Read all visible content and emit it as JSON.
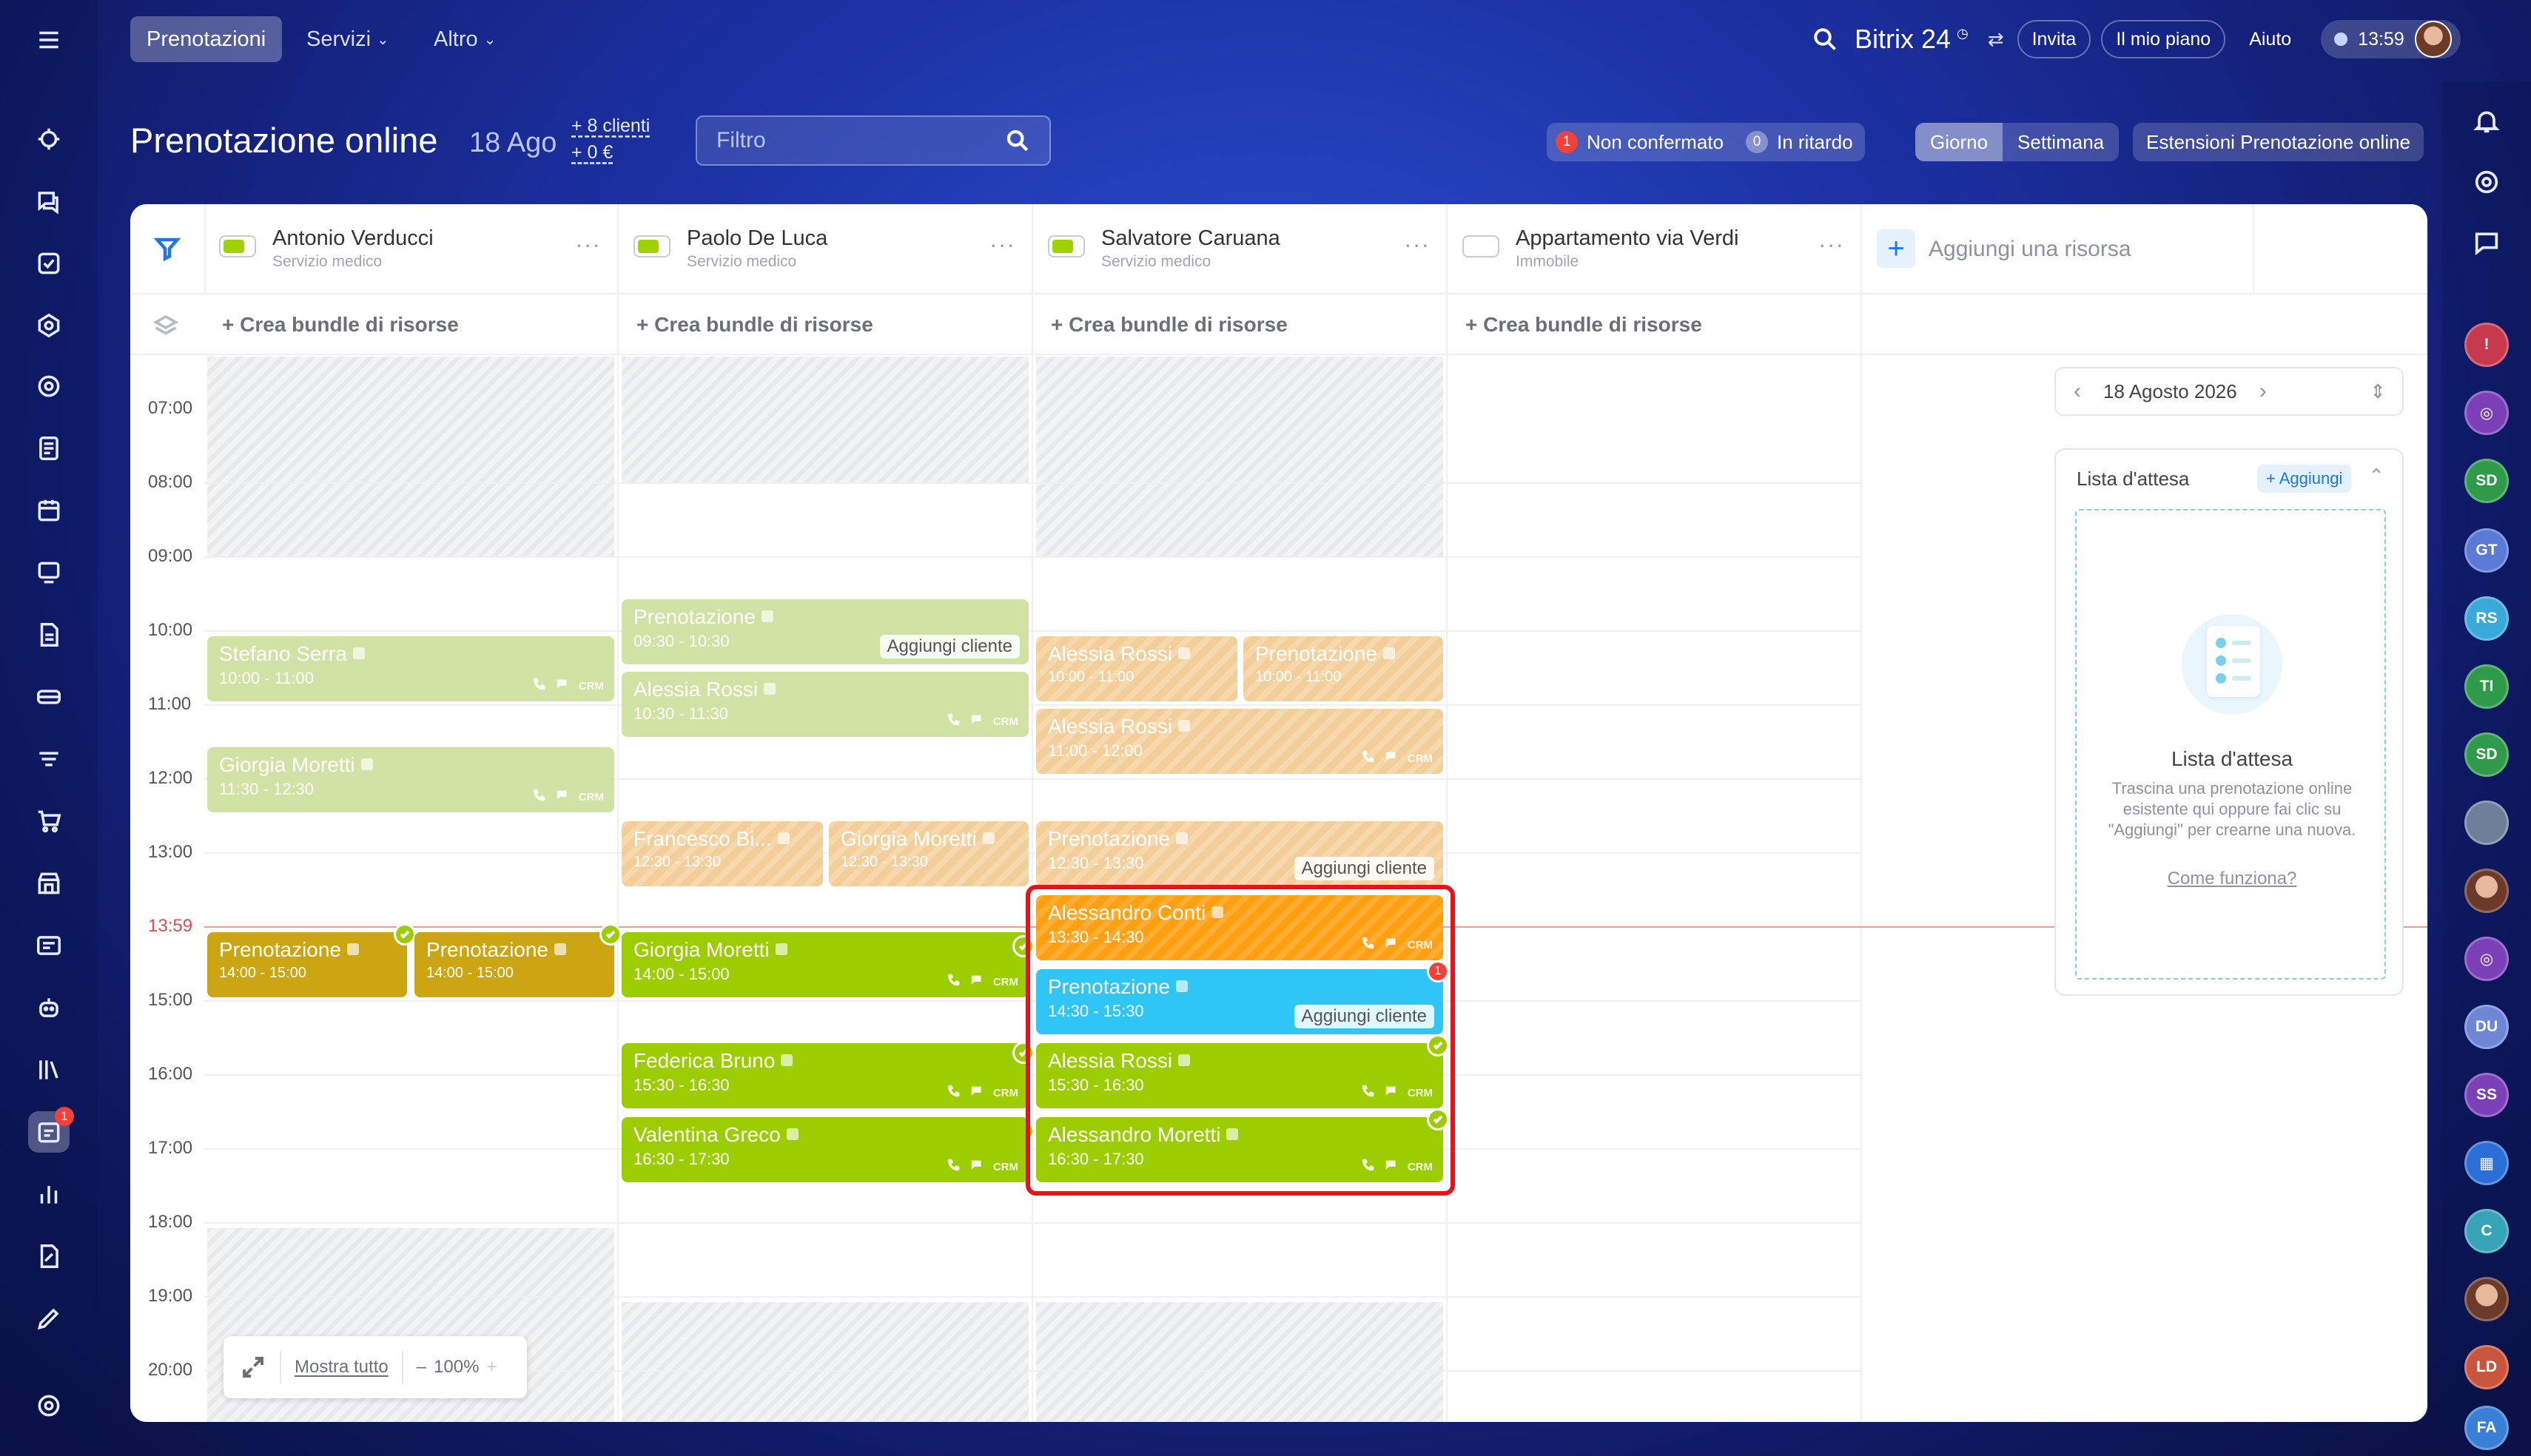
{
  "nav": {
    "tabs": [
      {
        "label": "Prenotazioni",
        "active": true
      },
      {
        "label": "Servizi",
        "active": false
      },
      {
        "label": "Altro",
        "active": false
      }
    ],
    "brand": "Bitrix 24",
    "invite": "Invita",
    "plan": "Il mio piano",
    "help": "Aiuto",
    "clock": "13:59"
  },
  "header": {
    "title": "Prenotazione online",
    "date": "18 Ago",
    "clients_stat": "+ 8 clienti",
    "revenue_stat": "+ 0 €",
    "filter_placeholder": "Filtro",
    "unconfirmed": {
      "count": "1",
      "label": "Non confermato"
    },
    "late": {
      "count": "0",
      "label": "In ritardo"
    },
    "view_day": "Giorno",
    "view_week": "Settimana",
    "extensions": "Estensioni Prenotazione online"
  },
  "resources": [
    {
      "name": "Antonio Verducci",
      "type": "Servizio medico",
      "enabled": true
    },
    {
      "name": "Paolo De Luca",
      "type": "Servizio medico",
      "enabled": true
    },
    {
      "name": "Salvatore Caruana",
      "type": "Servizio medico",
      "enabled": true
    },
    {
      "name": "Appartamento via Verdi",
      "type": "Immobile",
      "enabled": false
    }
  ],
  "add_resource": "Aggiungi una risorsa",
  "bundle_label": "+ Crea bundle di risorse",
  "times": [
    "07:00",
    "08:00",
    "09:00",
    "10:00",
    "11:00",
    "12:00",
    "13:00",
    "15:00",
    "16:00",
    "17:00",
    "18:00",
    "19:00",
    "20:00"
  ],
  "now_label": "13:59",
  "events": {
    "e1": {
      "title": "Stefano Serra",
      "time": "10:00 - 11:00",
      "crm": "CRM"
    },
    "e2": {
      "title": "Giorgia Moretti",
      "time": "11:30 - 12:30",
      "crm": "CRM"
    },
    "e3": {
      "title": "Prenotazione",
      "time": "14:00 - 15:00"
    },
    "e4": {
      "title": "Prenotazione",
      "time": "14:00 - 15:00"
    },
    "e5": {
      "title": "Prenotazione",
      "time": "09:30 - 10:30",
      "add": "Aggiungi cliente"
    },
    "e6": {
      "title": "Alessia Rossi",
      "time": "10:30 - 11:30",
      "crm": "CRM"
    },
    "e7": {
      "title": "Francesco Bi...",
      "time": "12:30 - 13:30"
    },
    "e8": {
      "title": "Giorgia Moretti",
      "time": "12:30 - 13:30"
    },
    "e9": {
      "title": "Giorgia Moretti",
      "time": "14:00 - 15:00",
      "crm": "CRM"
    },
    "e10": {
      "title": "Federica Bruno",
      "time": "15:30 - 16:30",
      "crm": "CRM"
    },
    "e11": {
      "title": "Valentina Greco",
      "time": "16:30 - 17:30",
      "crm": "CRM"
    },
    "e12": {
      "title": "Alessia Rossi",
      "time": "10:00 - 11:00"
    },
    "e13": {
      "title": "Prenotazione",
      "time": "10:00 - 11:00"
    },
    "e14": {
      "title": "Alessia Rossi",
      "time": "11:00 - 12:00",
      "crm": "CRM"
    },
    "e15": {
      "title": "Prenotazione",
      "time": "12:30 - 13:30",
      "add": "Aggiungi cliente"
    },
    "e16": {
      "title": "Alessandro Conti",
      "time": "13:30 - 14:30",
      "crm": "CRM"
    },
    "e17": {
      "title": "Prenotazione",
      "time": "14:30 - 15:30",
      "add": "Aggiungi cliente",
      "alert": "1"
    },
    "e18": {
      "title": "Alessia Rossi",
      "time": "15:30 - 16:30",
      "crm": "CRM"
    },
    "e19": {
      "title": "Alessandro Moretti",
      "time": "16:30 - 17:30",
      "crm": "CRM"
    }
  },
  "zoom": {
    "show_all": "Mostra tutto",
    "level": "100%",
    "minus": "–",
    "plus": "+"
  },
  "side": {
    "date": "18 Agosto 2026",
    "waitlist_title": "Lista d'attesa",
    "waitlist_add": "+ Aggiungi",
    "empty_title": "Lista d'attesa",
    "empty_text": "Trascina una prenotazione online esistente qui oppure fai clic su \"Aggiungi\" per crearne una nuova.",
    "how_link": "Come funziona?"
  },
  "left_rail_badge": "1",
  "right_rail": {
    "initials": [
      "SD",
      "GT",
      "RS",
      "TI",
      "SD",
      "DU",
      "SS",
      "C",
      "LD",
      "FA"
    ]
  },
  "colors": {
    "accent": "#1f77e6",
    "confirmed": "#9ccd00",
    "pending": "#ffa011",
    "unassigned": "#2fc6f6",
    "highlight": "#e8121a"
  }
}
